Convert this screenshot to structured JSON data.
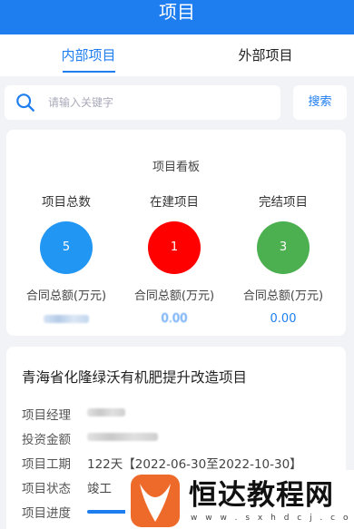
{
  "header": {
    "title": "项目"
  },
  "tabs": [
    {
      "label": "内部项目",
      "active": true
    },
    {
      "label": "外部项目",
      "active": false
    }
  ],
  "search": {
    "placeholder": "请输入关键字",
    "button_label": "搜索",
    "icon": "search-icon"
  },
  "board": {
    "title": "项目看板",
    "stats": [
      {
        "label": "项目总数",
        "count": "5",
        "color": "#2196f3",
        "amount_label": "合同总额(万元)",
        "amount": ""
      },
      {
        "label": "在建项目",
        "count": "1",
        "color": "#ff0000",
        "amount_label": "合同总额(万元)",
        "amount": "0.00"
      },
      {
        "label": "完结项目",
        "count": "3",
        "color": "#4caf50",
        "amount_label": "合同总额(万元)",
        "amount": "0.00"
      }
    ]
  },
  "project": {
    "name": "青海省化隆绿沃有机肥提升改造项目",
    "rows": [
      {
        "key": "项目经理",
        "value": ""
      },
      {
        "key": "投资金额",
        "value": ""
      },
      {
        "key": "项目工期",
        "value": "122天【2022-06-30至2022-10-30】"
      },
      {
        "key": "项目状态",
        "value": "竣工"
      },
      {
        "key": "项目进度",
        "value": ""
      }
    ],
    "progress": 0.25
  },
  "watermark": {
    "text": "恒达教程网",
    "url": "w w w . s x h d c j . c o m"
  },
  "colors": {
    "accent": "#1e7ef0",
    "background": "#f2f3f7"
  }
}
